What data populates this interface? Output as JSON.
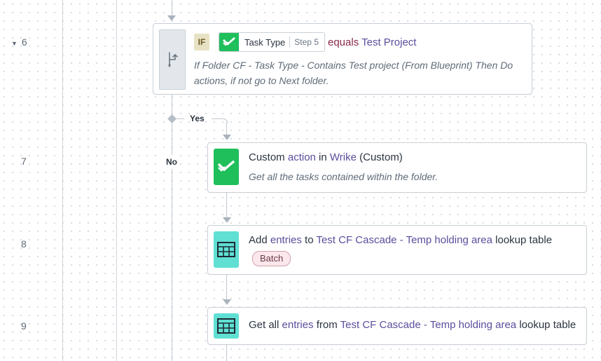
{
  "steps": {
    "numbers": [
      "6",
      "7",
      "8",
      "9"
    ]
  },
  "if_step": {
    "badge": "IF",
    "field_name": "Task Type",
    "field_step": "Step 5",
    "operator": "equals",
    "value": "Test Project",
    "description": "If Folder CF  - Task Type - Contains Test project (From Blueprint) Then Do actions, if not go to Next folder."
  },
  "branches": {
    "yes": "Yes",
    "no": "No"
  },
  "step7": {
    "part1": "Custom ",
    "link1": "action",
    "part2": " in ",
    "link2": "Wrike",
    "part3": " (Custom)",
    "subtitle": "Get all the tasks contained within the folder."
  },
  "step8": {
    "part1": "Add ",
    "link1": "entries",
    "part2": " to ",
    "link2": "Test CF Cascade - Temp holding area",
    "part3": " lookup table",
    "badge": "Batch"
  },
  "step9": {
    "part1": "Get all ",
    "link1": "entries",
    "part2": " from ",
    "link2": "Test CF Cascade - Temp holding area",
    "part3": " lookup table"
  },
  "icons": {
    "wrike": "wrike-check-icon",
    "table": "table-icon",
    "branch": "branch-icon",
    "collapse": "caret-down-icon"
  },
  "colors": {
    "wrike_green": "#1fbf5b",
    "table_teal": "#5fe0d3",
    "highlight": "#5a4e9c",
    "operator": "#8a2b4a"
  }
}
